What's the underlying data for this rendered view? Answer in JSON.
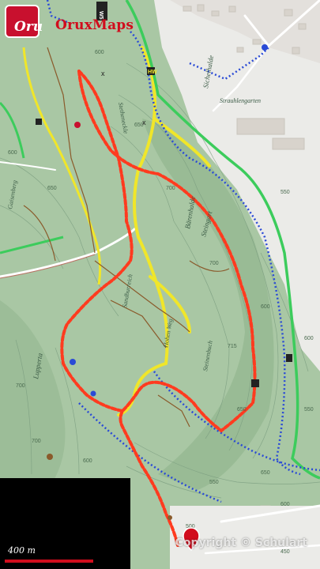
{
  "app": {
    "brand_name": "OruxMaps",
    "logo_text": "Oru",
    "logo_color": "#c8102e"
  },
  "map": {
    "scale_label": "400 m",
    "copyright": "Copyright © Schulart",
    "colors": {
      "forest": "#a9c7a4",
      "forest_dark": "#8fb38c",
      "open_area": "#e8e8e8",
      "track": "#ff3b1f",
      "trail_yellow": "#f0e62a",
      "trail_green": "#3ccc5c",
      "trail_blue": "#2a4ad6",
      "road": "#ffffff"
    },
    "place_labels": {
      "sichelhalde": "Sichelhalde",
      "barenhalde": "Bärenhalde",
      "steingart": "Steingart",
      "strauhlengarten": "Strauhlengarten",
      "gaisenberg": "Gaisenberg",
      "lupperta": "Lupperta",
      "stetheneckle": "Stetheneckle",
      "steinenbuch": "Steinenbuch",
      "sandburreich": "Sandburreich",
      "hoher_weg": "Hohen Weg",
      "ws": "W5",
      "top_badge": "HW"
    },
    "elevations": {
      "e1": "600",
      "e2": "650",
      "e3": "700",
      "e4": "700",
      "e5": "600",
      "e6": "650",
      "e7": "550",
      "e8": "600",
      "e9": "715",
      "e10": "650",
      "e11": "600",
      "e12": "550",
      "e13": "700",
      "e14": "600",
      "e15": "500",
      "e16": "550",
      "e17": "650",
      "e18": "600",
      "e19": "450",
      "e20": "700"
    },
    "cross_labels": {
      "c1": "x",
      "c2": "x"
    }
  }
}
